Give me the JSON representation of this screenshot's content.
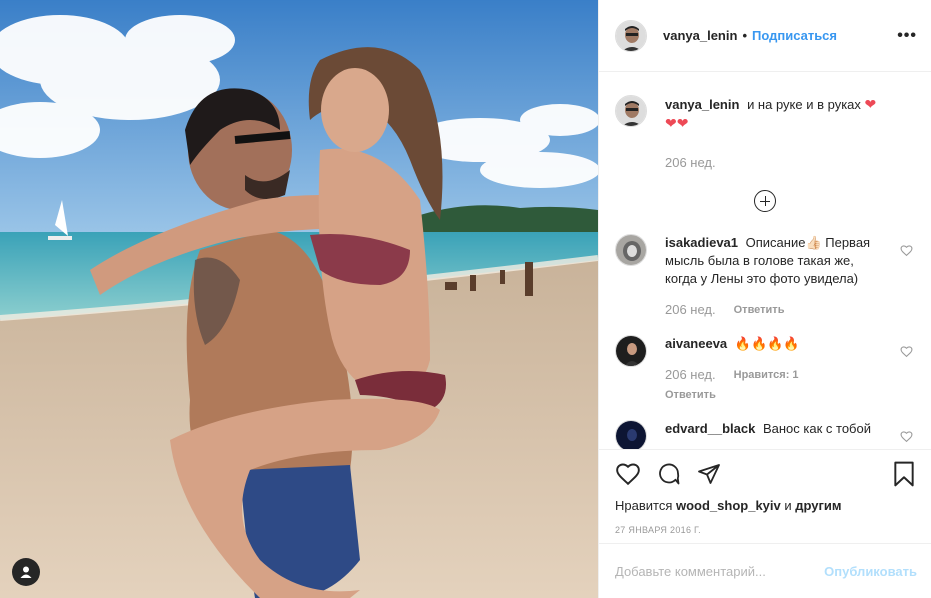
{
  "post": {
    "author": "vanya_lenin",
    "separator": "•",
    "follow_label": "Подписаться",
    "more_label": "•••",
    "caption": {
      "user": "vanya_lenin",
      "text": "и на руке и в руках",
      "emoji": "❤❤❤",
      "time": "206 нед."
    },
    "comments": [
      {
        "user": "isakadieva1",
        "text": "Описание👍🏻 Первая мысль была в голове такая же, когда у Лены это фото увидела)",
        "time": "206 нед.",
        "reply_label": "Ответить"
      },
      {
        "user": "aivaneeva",
        "text": "🔥🔥🔥🔥",
        "time": "206 нед.",
        "likes_label": "Нравится: 1",
        "reply_label": "Ответить"
      },
      {
        "user": "edvard__black",
        "text": "Ванос как с тобой"
      }
    ],
    "likes": {
      "prefix": "Нравится",
      "user": "wood_shop_kyiv",
      "suffix": "и",
      "others": "другим"
    },
    "date": "27 ЯНВАРЯ 2016 Г.",
    "add_comment_placeholder": "Добавьте комментарий...",
    "publish_label": "Опубликовать"
  },
  "colors": {
    "link": "#3897f0",
    "publish_disabled": "#b2dffc",
    "muted": "#999999",
    "text": "#262626"
  },
  "icons": {
    "like": "heart-outline-icon",
    "comment": "speech-bubble-icon",
    "share": "paper-plane-icon",
    "save": "bookmark-icon",
    "tagged_users": "user-silhouette-icon",
    "load_more": "plus-circle-icon"
  }
}
